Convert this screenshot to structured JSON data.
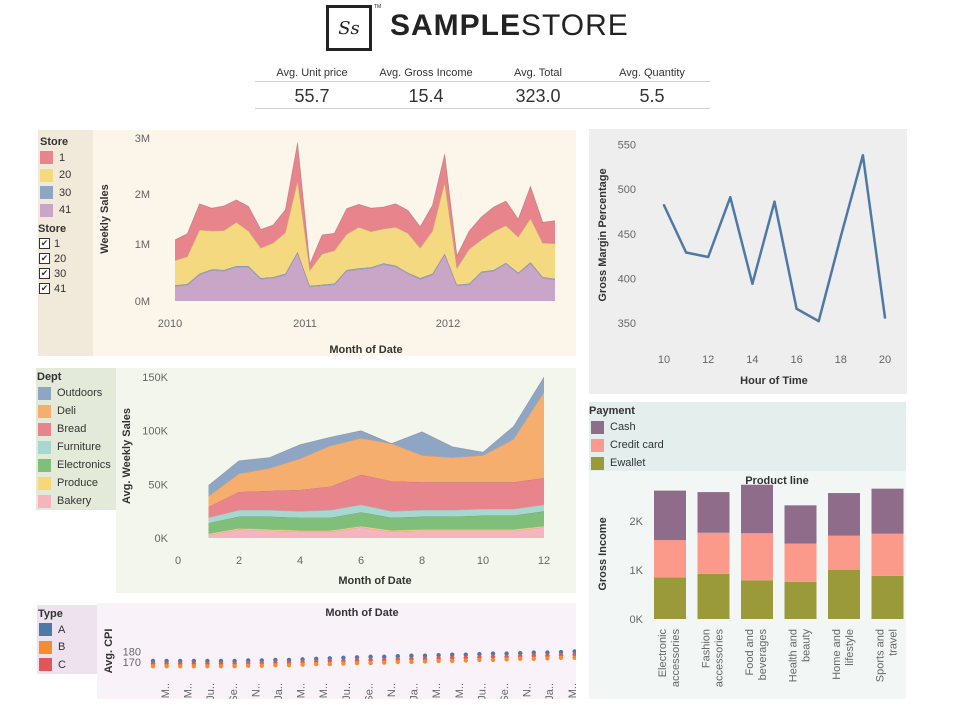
{
  "header": {
    "logo_monogram": "Ss",
    "logo_tm": "TM",
    "title_bold": "SAMPLE",
    "title_light": "STORE"
  },
  "kpis": [
    {
      "label": "Avg. Unit price",
      "value": "55.7"
    },
    {
      "label": "Avg. Gross Income",
      "value": "15.4"
    },
    {
      "label": "Avg. Total",
      "value": "323.0"
    },
    {
      "label": "Avg. Quantity",
      "value": "5.5"
    }
  ],
  "colors": {
    "panel_cream": "#fbf5ea",
    "panel_tan": "#f1e9d9",
    "panel_green": "#f2f6ec",
    "panel_green_legend": "#e4ead9",
    "panel_grey": "#eeeeee",
    "panel_teal": "#e4efed",
    "panel_pink": "#f9f3f9",
    "panel_pink_legend": "#ede2ed"
  },
  "store_legend": {
    "title": "Store",
    "items": [
      {
        "label": "1",
        "color": "#e8858c"
      },
      {
        "label": "20",
        "color": "#f5d981"
      },
      {
        "label": "30",
        "color": "#8ea6c3"
      },
      {
        "label": "41",
        "color": "#c9a6c8"
      }
    ],
    "filter_title": "Store",
    "filter_items": [
      "1",
      "20",
      "30",
      "41"
    ],
    "check_glyph": "✔"
  },
  "dept_legend": {
    "title": "Dept",
    "items": [
      {
        "label": "Outdoors",
        "color": "#8ea6c3"
      },
      {
        "label": "Deli",
        "color": "#f5ae6e"
      },
      {
        "label": "Bread",
        "color": "#e8858c"
      },
      {
        "label": "Furniture",
        "color": "#a7d7d1"
      },
      {
        "label": "Electronics",
        "color": "#7fbf7a"
      },
      {
        "label": "Produce",
        "color": "#f7d77a"
      },
      {
        "label": "Bakery",
        "color": "#f6b4bf"
      }
    ]
  },
  "type_legend": {
    "title": "Type",
    "items": [
      {
        "label": "A",
        "color": "#4e79a7"
      },
      {
        "label": "B",
        "color": "#f28e2b"
      },
      {
        "label": "C",
        "color": "#e15759"
      }
    ]
  },
  "payment_legend": {
    "title": "Payment",
    "items": [
      {
        "label": "Cash",
        "color": "#8e6c8a"
      },
      {
        "label": "Credit card",
        "color": "#fb9a8a"
      },
      {
        "label": "Ewallet",
        "color": "#9a9a3a"
      }
    ]
  },
  "chart_data": [
    {
      "type": "area",
      "ylabel": "Weekly Sales",
      "xlabel": "Month of Date",
      "x_ticks": [
        "2010",
        "2011",
        "2012"
      ],
      "y_ticks": [
        "0M",
        "1M",
        "2M",
        "3M"
      ],
      "ylim": [
        0,
        3000000
      ],
      "stacked": true,
      "x_months": [
        0,
        1,
        2,
        3,
        4,
        5,
        6,
        7,
        8,
        9,
        10,
        11,
        12,
        13,
        14,
        15,
        16,
        17,
        18,
        19,
        20,
        21,
        22,
        23,
        24,
        25,
        26,
        27,
        28,
        29,
        30,
        31
      ],
      "series": [
        {
          "name": "41",
          "color": "#c9a6c8",
          "values": [
            270000,
            290000,
            480000,
            560000,
            550000,
            620000,
            620000,
            400000,
            420000,
            480000,
            880000,
            260000,
            280000,
            300000,
            550000,
            580000,
            600000,
            670000,
            630000,
            500000,
            400000,
            480000,
            850000,
            280000,
            300000,
            520000,
            550000,
            680000,
            500000,
            690000,
            420000,
            390000
          ]
        },
        {
          "name": "30",
          "color": "#8ea6c3",
          "values": [
            20000,
            20000,
            20000,
            20000,
            20000,
            20000,
            20000,
            20000,
            20000,
            20000,
            20000,
            20000,
            20000,
            20000,
            20000,
            20000,
            20000,
            20000,
            20000,
            20000,
            20000,
            20000,
            20000,
            20000,
            20000,
            20000,
            20000,
            20000,
            20000,
            20000,
            20000,
            20000
          ]
        },
        {
          "name": "20",
          "color": "#f5d981",
          "values": [
            450000,
            500000,
            800000,
            700000,
            720000,
            800000,
            640000,
            550000,
            620000,
            750000,
            1300000,
            280000,
            560000,
            600000,
            650000,
            750000,
            650000,
            630000,
            700000,
            720000,
            550000,
            780000,
            1300000,
            300000,
            630000,
            580000,
            700000,
            680000,
            650000,
            800000,
            620000,
            640000
          ]
        },
        {
          "name": "1",
          "color": "#e8858c",
          "values": [
            380000,
            420000,
            480000,
            420000,
            450000,
            410000,
            450000,
            340000,
            330000,
            420000,
            700000,
            120000,
            350000,
            320000,
            470000,
            420000,
            430000,
            400000,
            430000,
            420000,
            390000,
            470000,
            520000,
            230000,
            330000,
            420000,
            450000,
            450000,
            330000,
            590000,
            380000,
            420000
          ]
        }
      ]
    },
    {
      "type": "line",
      "ylabel": "Gross Margin Percentage",
      "xlabel": "Hour of Time",
      "x": [
        10,
        11,
        12,
        13,
        14,
        15,
        16,
        17,
        18,
        19,
        20
      ],
      "y": [
        482,
        429,
        424,
        491,
        394,
        486,
        366,
        352,
        447,
        538,
        356
      ],
      "x_ticks": [
        "10",
        "12",
        "14",
        "16",
        "18",
        "20"
      ],
      "y_ticks": [
        "350",
        "400",
        "450",
        "500",
        "550"
      ],
      "xlim": [
        9.5,
        20.7
      ],
      "ylim": [
        335,
        560
      ],
      "color": "#4e79a7"
    },
    {
      "type": "area",
      "ylabel": "Avg. Weekly Sales",
      "xlabel": "Month of Date",
      "x": [
        1,
        2,
        3,
        4,
        5,
        6,
        7,
        8,
        9,
        10,
        11,
        12
      ],
      "x_ticks": [
        "0",
        "2",
        "4",
        "6",
        "8",
        "10",
        "12"
      ],
      "y_ticks": [
        "0K",
        "50K",
        "100K",
        "150K"
      ],
      "xlim": [
        0,
        12.3
      ],
      "ylim": [
        0,
        153000
      ],
      "stacked": true,
      "series": [
        {
          "name": "Bakery",
          "color": "#f6b4bf",
          "values": [
            3000,
            8000,
            7000,
            6000,
            6000,
            10000,
            6000,
            7000,
            7000,
            7000,
            7000,
            10000
          ]
        },
        {
          "name": "Produce",
          "color": "#f7d77a",
          "values": [
            1000,
            1000,
            1000,
            1000,
            1000,
            1000,
            1000,
            1000,
            1000,
            1000,
            1000,
            1000
          ]
        },
        {
          "name": "Electronics",
          "color": "#7fbf7a",
          "values": [
            10000,
            11000,
            12000,
            12000,
            12000,
            13000,
            12000,
            12000,
            12000,
            13000,
            13000,
            14000
          ]
        },
        {
          "name": "Furniture",
          "color": "#a7d7d1",
          "values": [
            5000,
            6000,
            6000,
            6000,
            7000,
            7000,
            6000,
            6000,
            6000,
            6000,
            6000,
            6000
          ]
        },
        {
          "name": "Bread",
          "color": "#e8858c",
          "values": [
            10000,
            17000,
            18000,
            20000,
            22000,
            28000,
            28000,
            26000,
            26000,
            25000,
            25000,
            25000
          ]
        },
        {
          "name": "Deli",
          "color": "#f5ae6e",
          "values": [
            10000,
            17000,
            21000,
            29000,
            38000,
            34000,
            35000,
            25000,
            23000,
            25000,
            40000,
            80000
          ]
        },
        {
          "name": "Outdoors",
          "color": "#8ea6c3",
          "values": [
            10000,
            12000,
            10000,
            13000,
            8000,
            7000,
            0,
            22000,
            10000,
            3000,
            12000,
            14000
          ]
        }
      ]
    },
    {
      "type": "bar",
      "title": "Product line",
      "ylabel": "Gross Income",
      "categories": [
        "Electronic accessories",
        "Fashion accessories",
        "Food and beverages",
        "Health and beauty",
        "Home and lifestyle",
        "Sports and travel"
      ],
      "category_lines": [
        [
          "Electronic",
          "accessories"
        ],
        [
          "Fashion",
          "accessories"
        ],
        [
          "Food and",
          "beverages"
        ],
        [
          "Health and",
          "beauty"
        ],
        [
          "Home and",
          "lifestyle"
        ],
        [
          "Sports and",
          "travel"
        ]
      ],
      "y_ticks": [
        "0K",
        "1K",
        "2K"
      ],
      "ylim": [
        0,
        2800
      ],
      "stacked": true,
      "series": [
        {
          "name": "Ewallet",
          "color": "#9a9a3a",
          "values": [
            850,
            920,
            790,
            760,
            1000,
            880
          ]
        },
        {
          "name": "Credit card",
          "color": "#fb9a8a",
          "values": [
            760,
            840,
            960,
            780,
            700,
            860
          ]
        },
        {
          "name": "Cash",
          "color": "#8e6c8a",
          "values": [
            1010,
            830,
            990,
            780,
            870,
            920
          ]
        }
      ]
    },
    {
      "type": "scatter",
      "title": "Month of Date",
      "ylabel": "Avg. CPI",
      "y_ticks": [
        "170",
        "180"
      ],
      "ylim": [
        164,
        183
      ],
      "x_ticks": [
        "M..",
        "M..",
        "Ju..",
        "Se..",
        "N..",
        "Ja..",
        "M..",
        "M..",
        "Ju..",
        "Se..",
        "N..",
        "Ja..",
        "M..",
        "M..",
        "Ju..",
        "Se..",
        "N..",
        "Ja..",
        "M.."
      ],
      "series": [
        {
          "name": "A",
          "color": "#4e79a7",
          "values": [
            171,
            171,
            171,
            171,
            171,
            171,
            171,
            171.5,
            171.5,
            172,
            172,
            172.5,
            173,
            173.5,
            174,
            174.5,
            175,
            175,
            175.5,
            176,
            176,
            176.5,
            177,
            177,
            177.5,
            178,
            178,
            178.5,
            179,
            179,
            179.5,
            180
          ]
        },
        {
          "name": "C",
          "color": "#e15759",
          "values": [
            168.5,
            168.5,
            168.5,
            168.5,
            168.5,
            168.5,
            168.5,
            169,
            169,
            169.5,
            169.5,
            170,
            170.5,
            171,
            171,
            171.5,
            172,
            172,
            172.5,
            173,
            173,
            173.5,
            174,
            174,
            174.5,
            175,
            175,
            175.5,
            176,
            176,
            176.5,
            177
          ]
        },
        {
          "name": "B",
          "color": "#f28e2b",
          "values": [
            166,
            166,
            166,
            166,
            166,
            166,
            166,
            166.5,
            166.5,
            167,
            167,
            167.5,
            168,
            168,
            168.5,
            169,
            169,
            169.5,
            170,
            170,
            170.5,
            171,
            171,
            171.5,
            172,
            172,
            172.5,
            173,
            173,
            173.5,
            174,
            174
          ]
        }
      ]
    }
  ]
}
